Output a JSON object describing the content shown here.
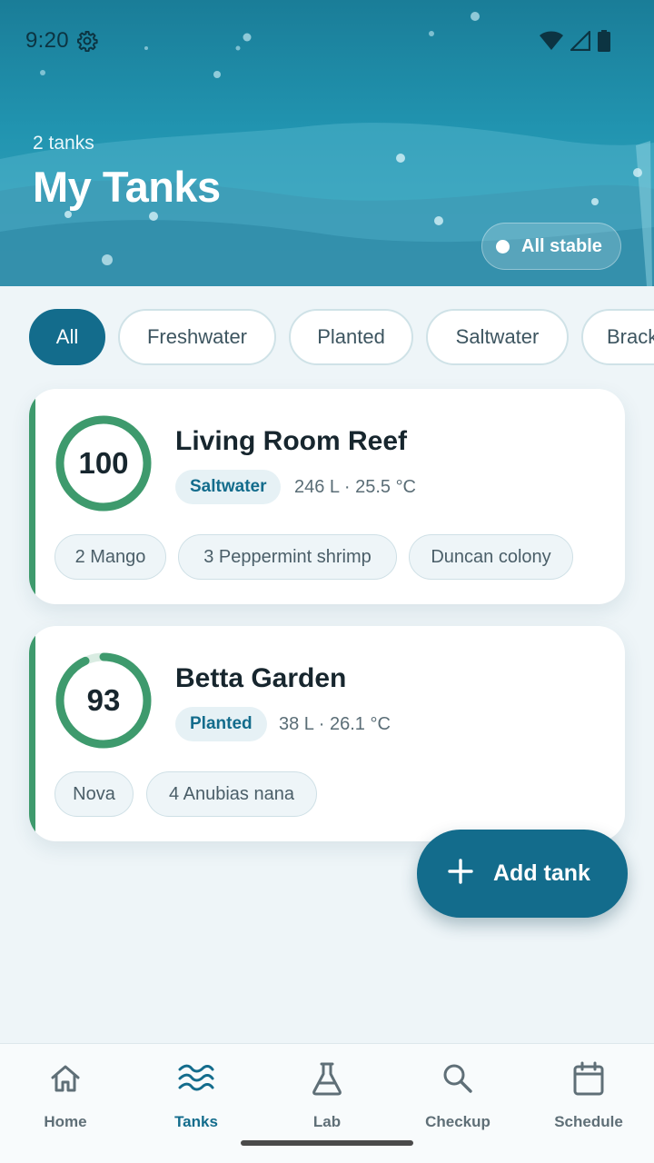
{
  "status_bar": {
    "time": "9:20",
    "icons": [
      "gear-icon",
      "wifi-icon",
      "cellular-signal-icon",
      "battery-icon"
    ]
  },
  "header": {
    "tank_count": "2 tanks",
    "title": "My Tanks",
    "status_pill": "All stable"
  },
  "filters": {
    "chips": [
      {
        "label": "All",
        "active": true
      },
      {
        "label": "Freshwater",
        "active": false
      },
      {
        "label": "Planted",
        "active": false
      },
      {
        "label": "Saltwater",
        "active": false
      },
      {
        "label": "Brackish",
        "active": false
      }
    ]
  },
  "tanks": [
    {
      "score": "100",
      "score_value": 100,
      "name": "Living Room Reef",
      "type": "Saltwater",
      "meta": "246 L · 25.5 °C",
      "livestock": [
        "2 Mango",
        "3 Peppermint shrimp",
        "Duncan colony"
      ]
    },
    {
      "score": "93",
      "score_value": 93,
      "name": "Betta Garden",
      "type": "Planted",
      "meta": "38 L · 26.1 °C",
      "livestock": [
        "Nova",
        "4 Anubias nana"
      ]
    }
  ],
  "fab": {
    "label": "Add tank",
    "icon": "plus-icon"
  },
  "bottom_nav": [
    {
      "label": "Home",
      "icon": "home-icon",
      "active": false
    },
    {
      "label": "Tanks",
      "icon": "waves-icon",
      "active": true
    },
    {
      "label": "Lab",
      "icon": "flask-icon",
      "active": false
    },
    {
      "label": "Checkup",
      "icon": "search-icon",
      "active": false
    },
    {
      "label": "Schedule",
      "icon": "calendar-icon",
      "active": false
    }
  ],
  "colors": {
    "primary": "#136c8c",
    "health_ring": "#3e9a6d",
    "header_top": "#1a7d98",
    "background": "#eef5f8"
  }
}
